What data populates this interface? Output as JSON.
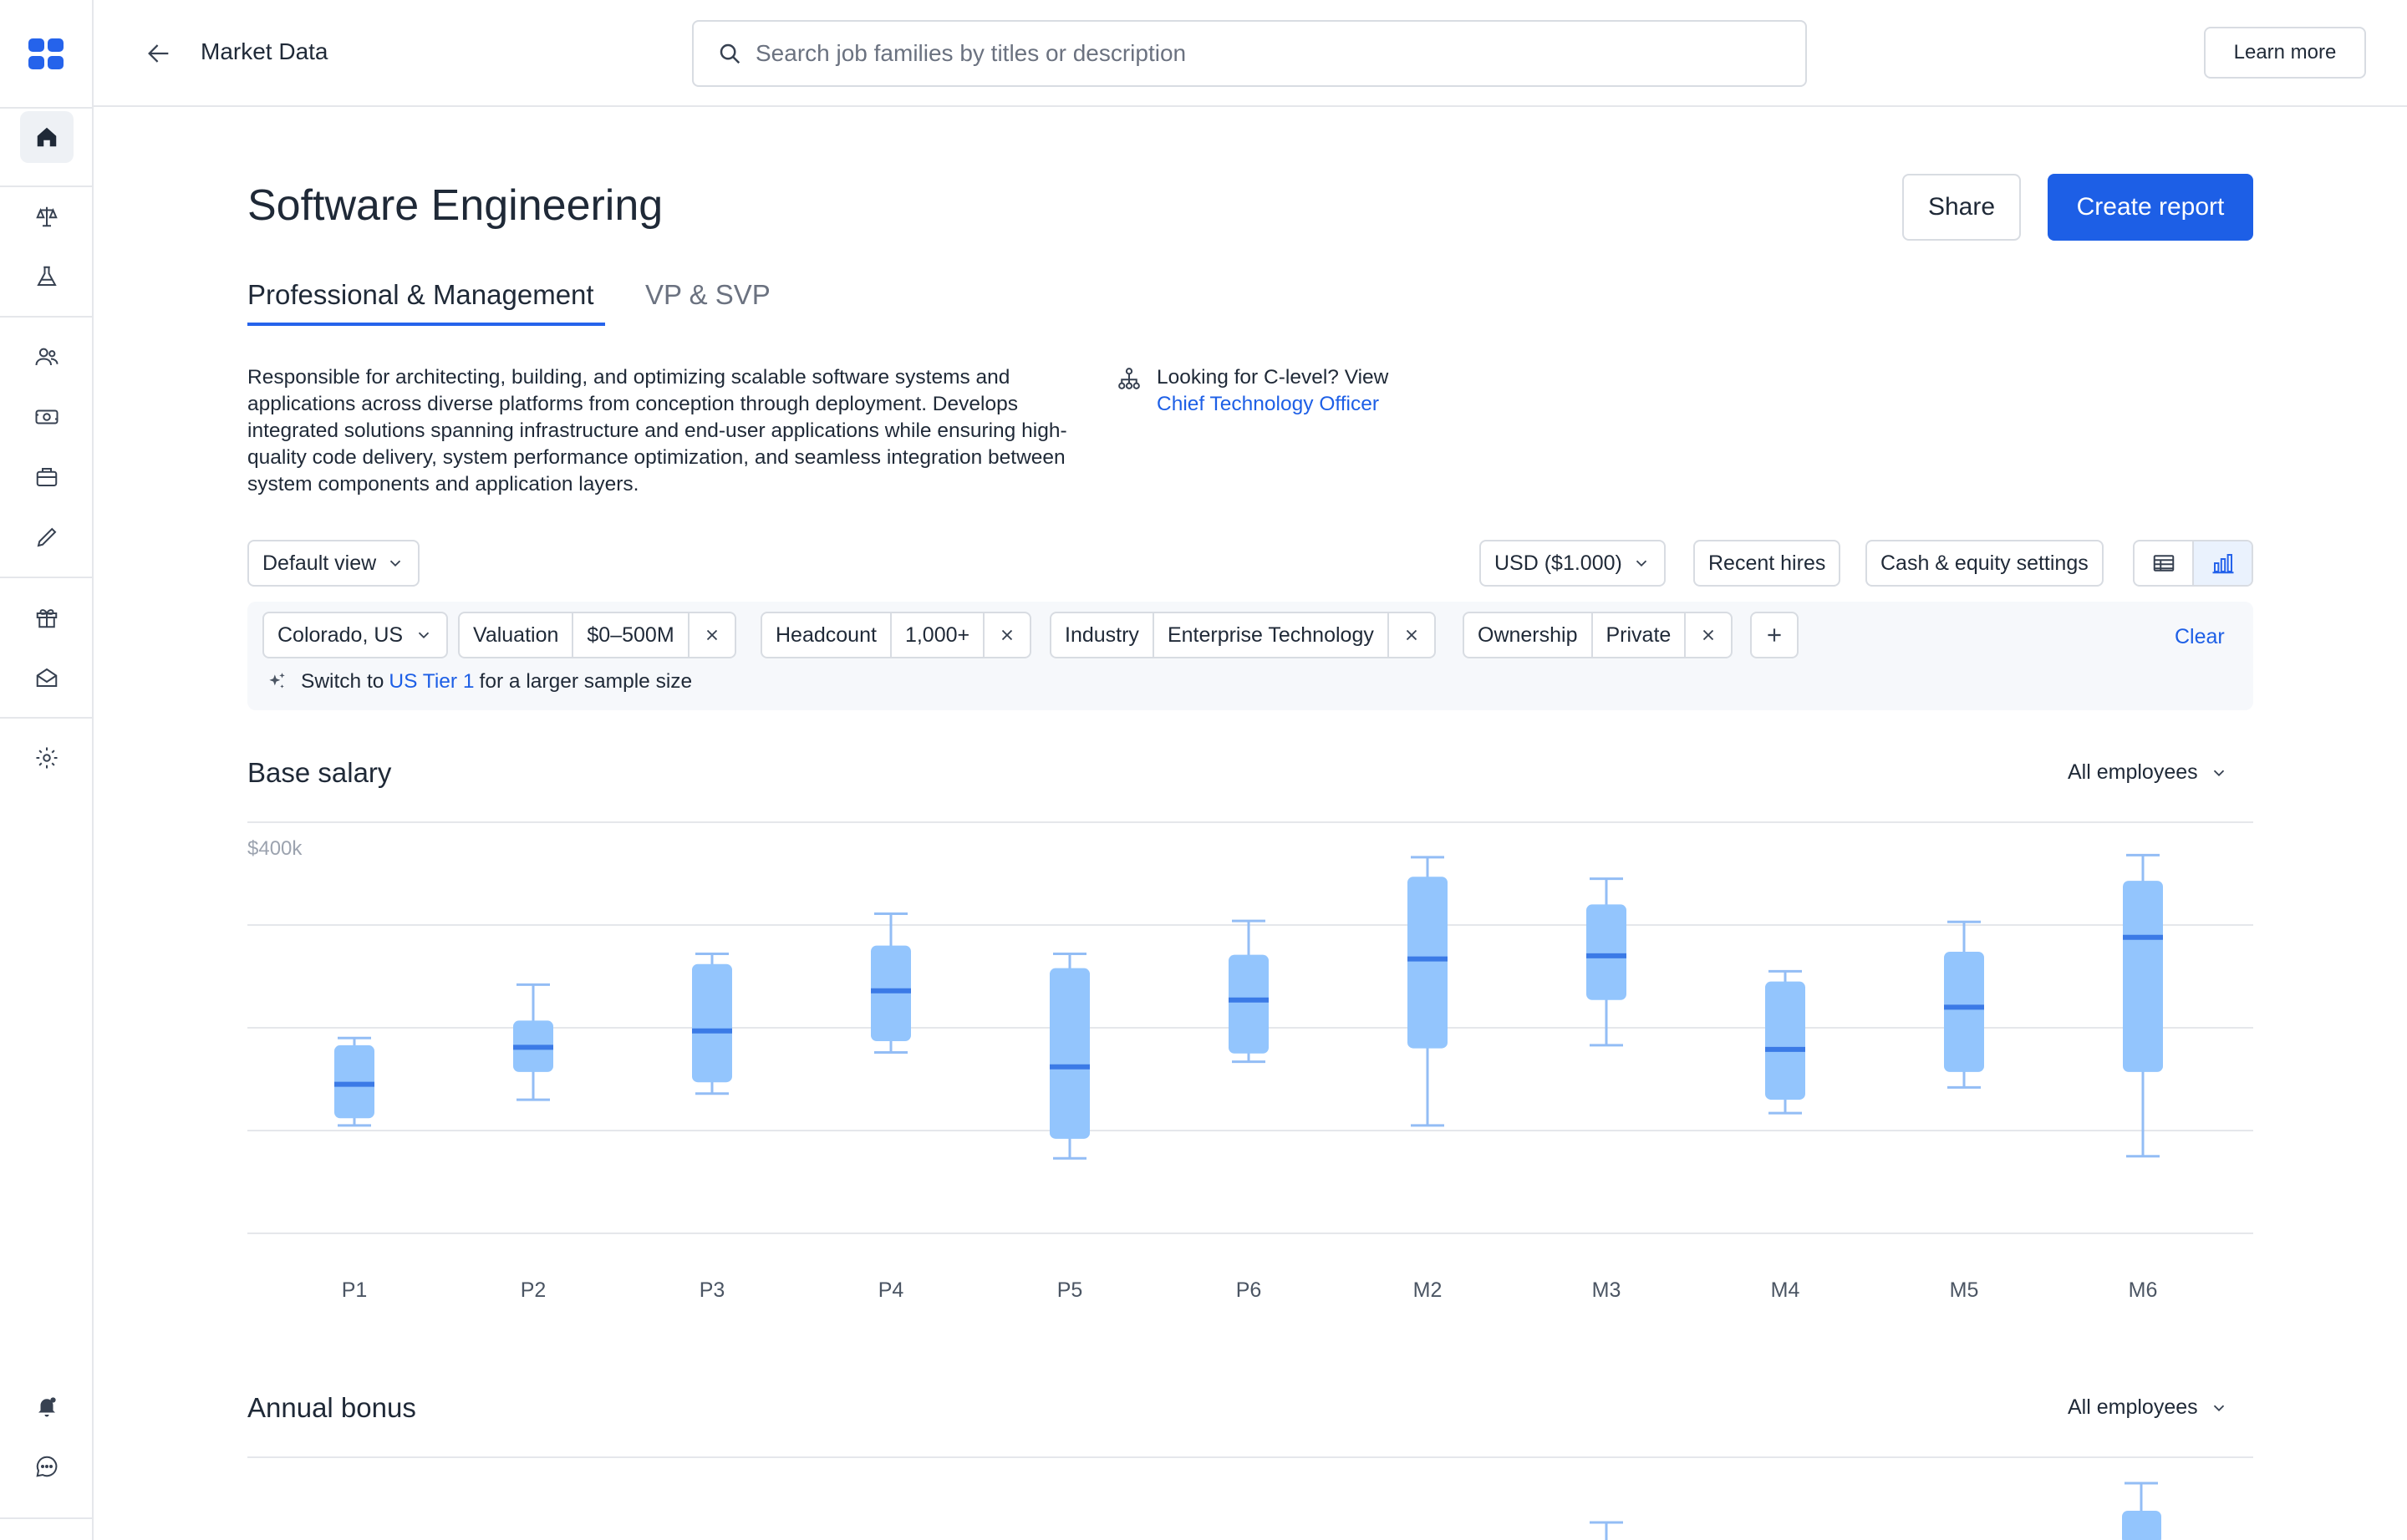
{
  "app": {
    "title": "Market Data"
  },
  "search": {
    "placeholder": "Search job families by titles or description"
  },
  "header": {
    "learn_more": "Learn more",
    "share": "Share",
    "create_report": "Create report"
  },
  "page": {
    "title": "Software Engineering",
    "tabs": [
      {
        "label": "Professional & Management",
        "active": true
      },
      {
        "label": "VP & SVP",
        "active": false
      }
    ],
    "description": "Responsible for architecting, building, and optimizing scalable software systems and applications across diverse platforms from conception through deployment. Develops integrated solutions spanning infrastructure and end-user applications while ensuring high-quality code delivery, system performance optimization, and seamless integration between system components and application layers.",
    "clevel_prompt": "Looking for C-level? View",
    "clevel_link": "Chief Technology Officer"
  },
  "controls": {
    "view": "Default view",
    "currency": "USD ($1.000)",
    "recent_hires": "Recent hires",
    "cash_equity": "Cash & equity settings"
  },
  "filters": {
    "location": "Colorado, US",
    "chips": [
      {
        "label": "Valuation",
        "value": "$0–500M"
      },
      {
        "label": "Headcount",
        "value": "1,000+"
      },
      {
        "label": "Industry",
        "value": "Enterprise Technology"
      },
      {
        "label": "Ownership",
        "value": "Private"
      }
    ],
    "clear": "Clear",
    "tip_prefix": "Switch to",
    "tip_link": "US Tier 1",
    "tip_suffix": "for a larger sample size"
  },
  "sections": {
    "base_salary": {
      "title": "Base salary",
      "filter": "All employees"
    },
    "annual_bonus": {
      "title": "Annual bonus",
      "filter": "All employees"
    }
  },
  "colors": {
    "accent": "#1d5fe6",
    "box_fill": "#93c5fd",
    "box_median": "#3b7ae6",
    "whisker": "#93bdf5"
  },
  "chart_data": {
    "type": "box",
    "title": "Base salary",
    "ylabel": "",
    "y_top_label": "$400k",
    "ylim": [
      0,
      400000
    ],
    "categories": [
      "P1",
      "P2",
      "P3",
      "P4",
      "P5",
      "P6",
      "M2",
      "M3",
      "M4",
      "M5",
      "M6"
    ],
    "boxes": [
      {
        "min": 105000,
        "q1": 112000,
        "median": 145000,
        "q3": 183000,
        "max": 190000
      },
      {
        "min": 130000,
        "q1": 157000,
        "median": 181000,
        "q3": 207000,
        "max": 242000
      },
      {
        "min": 136000,
        "q1": 147000,
        "median": 197000,
        "q3": 262000,
        "max": 272000
      },
      {
        "min": 176000,
        "q1": 187000,
        "median": 236000,
        "q3": 280000,
        "max": 311000
      },
      {
        "min": 73000,
        "q1": 92000,
        "median": 162000,
        "q3": 258000,
        "max": 272000
      },
      {
        "min": 167000,
        "q1": 175000,
        "median": 227000,
        "q3": 271000,
        "max": 304000
      },
      {
        "min": 105000,
        "q1": 180000,
        "median": 267000,
        "q3": 347000,
        "max": 366000
      },
      {
        "min": 183000,
        "q1": 227000,
        "median": 270000,
        "q3": 320000,
        "max": 345000
      },
      {
        "min": 117000,
        "q1": 130000,
        "median": 179000,
        "q3": 245000,
        "max": 255000
      },
      {
        "min": 142000,
        "q1": 157000,
        "median": 220000,
        "q3": 274000,
        "max": 303000
      },
      {
        "min": 75000,
        "q1": 157000,
        "median": 288000,
        "q3": 343000,
        "max": 368000
      }
    ],
    "grid": true
  }
}
